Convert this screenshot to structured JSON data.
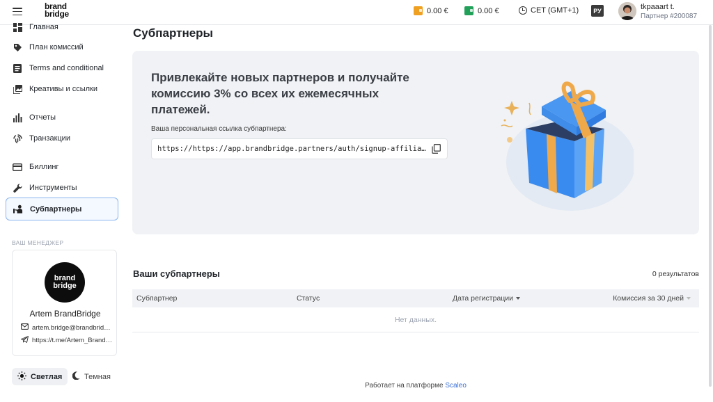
{
  "header": {
    "logo_line1": "brand",
    "logo_line2": "bridge",
    "wallet1": "0.00 €",
    "wallet2": "0.00 €",
    "timezone": "CET (GMT+1)",
    "language": "РУ",
    "user_name": "tkpaaart t.",
    "user_id": "Партнер #200087",
    "colors": {
      "wallet1": "#f0a020",
      "wallet2": "#22a05a"
    }
  },
  "sidebar": {
    "items": [
      {
        "label": "Главная",
        "icon": "dashboard-icon"
      },
      {
        "label": "План комиссий",
        "icon": "tag-icon"
      },
      {
        "label": "Terms and conditional",
        "icon": "document-icon"
      },
      {
        "label": "Креативы и ссылки",
        "icon": "images-icon"
      },
      {
        "label": "Отчеты",
        "icon": "bar-chart-icon"
      },
      {
        "label": "Транзакции",
        "icon": "fingerprint-icon"
      },
      {
        "label": "Биллинг",
        "icon": "credit-card-icon"
      },
      {
        "label": "Инструменты",
        "icon": "wrench-icon"
      },
      {
        "label": "Субпартнеры",
        "icon": "subpartners-icon",
        "active": true
      }
    ],
    "manager_title": "ВАШ МЕНЕДЖЕР",
    "manager": {
      "logo_line1": "brand",
      "logo_line2": "bridge",
      "name": "Artem BrandBridge",
      "email": "artem.bridge@brandbridge.partners",
      "telegram": "https://t.me/Artem_BrandBridge"
    },
    "theme_light": "Светлая",
    "theme_dark": "Темная"
  },
  "main": {
    "title": "Субпартнеры",
    "banner": {
      "heading": "Привлекайте новых партнеров и получайте комиссию 3% со всех их ежемесячных платежей.",
      "link_label": "Ваша персональная ссылка субпартнера:",
      "link_value": "https://https://app.brandbridge.partners/auth/signup-affiliate"
    },
    "subpartners_title": "Ваши субпартнеры",
    "results": "0 результатов",
    "table": {
      "columns": [
        "Субпартнер",
        "Статус",
        "Дата регистрации",
        "Комиссия за 30 дней"
      ],
      "empty_text": "Нет данных."
    },
    "footer_text": "Работает на платформе",
    "footer_link": "Scaleo"
  }
}
